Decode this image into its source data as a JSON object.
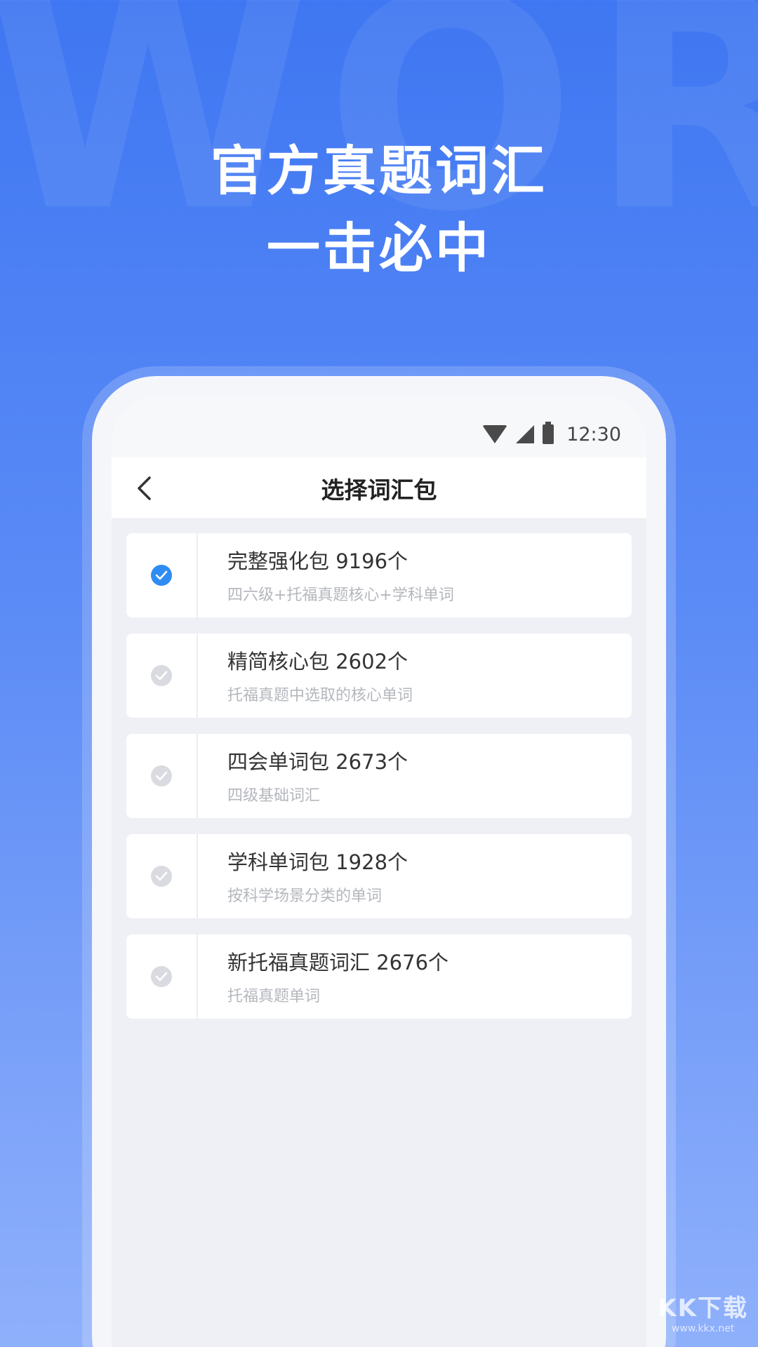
{
  "promo": {
    "background_word": "WORD",
    "headline_line1": "官方真题词汇",
    "headline_line2": "一击必中"
  },
  "status_bar": {
    "time": "12:30",
    "icons": [
      "wifi-icon",
      "cellular-signal-icon",
      "battery-icon"
    ]
  },
  "header": {
    "back_icon": "chevron-left-icon",
    "title": "选择词汇包"
  },
  "packages": [
    {
      "title": "完整强化包 9196个",
      "subtitle": "四六级+托福真题核心+学科单词",
      "selected": true
    },
    {
      "title": "精简核心包 2602个",
      "subtitle": "托福真题中选取的核心单词",
      "selected": false
    },
    {
      "title": "四会单词包 2673个",
      "subtitle": "四级基础词汇",
      "selected": false
    },
    {
      "title": "学科单词包 1928个",
      "subtitle": "按科学场景分类的单词",
      "selected": false
    },
    {
      "title": "新托福真题词汇 2676个",
      "subtitle": "托福真题单词",
      "selected": false
    }
  ],
  "watermark": {
    "main": "KK下载",
    "sub": "www.kkx.net"
  },
  "colors": {
    "background_top": "#3f77f2",
    "background_bottom": "#8fb0fb",
    "accent_check": "#2f8cf3",
    "inactive_check": "#d9dbe0"
  }
}
